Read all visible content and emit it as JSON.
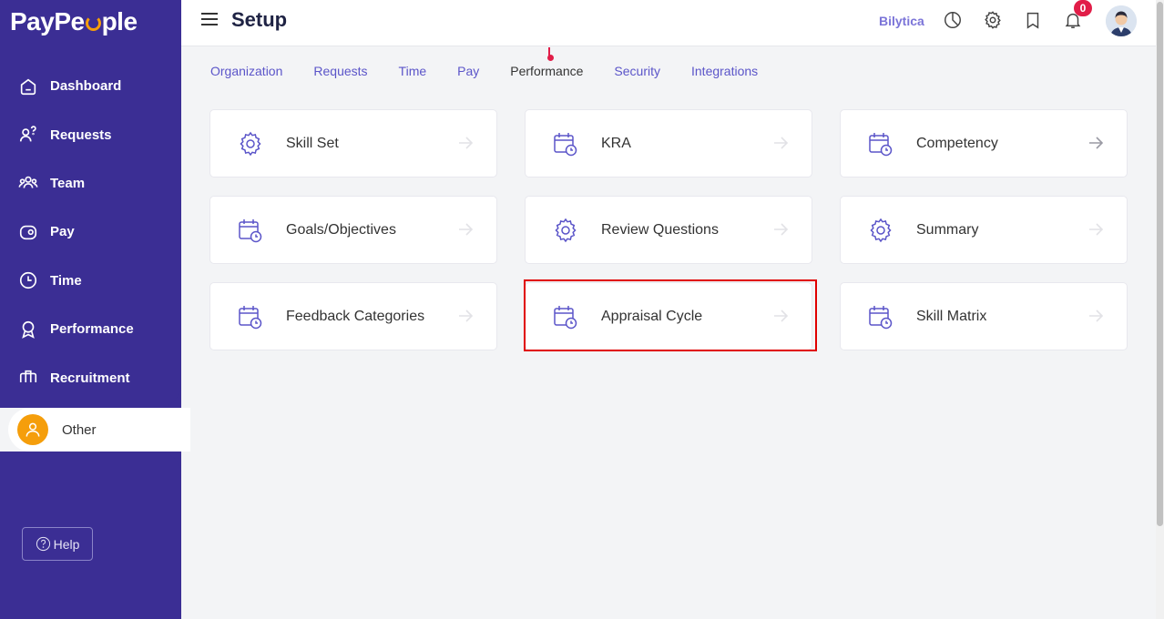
{
  "app": {
    "logo_text_a": "PayPe",
    "logo_text_b": "ple"
  },
  "sidebar": {
    "items": [
      {
        "label": "Dashboard",
        "icon": "home-icon"
      },
      {
        "label": "Requests",
        "icon": "requests-icon"
      },
      {
        "label": "Team",
        "icon": "team-icon"
      },
      {
        "label": "Pay",
        "icon": "wallet-icon"
      },
      {
        "label": "Time",
        "icon": "clock-icon"
      },
      {
        "label": "Performance",
        "icon": "award-icon"
      },
      {
        "label": "Recruitment",
        "icon": "briefcase-icon"
      }
    ],
    "active": {
      "label": "Other",
      "icon": "user-icon"
    },
    "help_label": "Help"
  },
  "header": {
    "title": "Setup",
    "company": "Bilytica",
    "notifications_count": "0"
  },
  "tabs": [
    "Organization",
    "Requests",
    "Time",
    "Pay",
    "Performance",
    "Security",
    "Integrations"
  ],
  "active_tab": "Performance",
  "cards": [
    {
      "label": "Skill Set",
      "icon": "gear-icon"
    },
    {
      "label": "KRA",
      "icon": "calendar-clock-icon"
    },
    {
      "label": "Competency",
      "icon": "calendar-clock-icon"
    },
    {
      "label": "Goals/Objectives",
      "icon": "calendar-clock-icon"
    },
    {
      "label": "Review Questions",
      "icon": "gear-icon"
    },
    {
      "label": "Summary",
      "icon": "gear-icon"
    },
    {
      "label": "Feedback Categories",
      "icon": "calendar-clock-icon"
    },
    {
      "label": "Appraisal Cycle",
      "icon": "calendar-clock-icon"
    },
    {
      "label": "Skill Matrix",
      "icon": "calendar-clock-icon"
    }
  ],
  "colors": {
    "sidebar": "#3b2e94",
    "accent": "#5b55c9",
    "highlight": "#e00000",
    "badge": "#e11d48"
  }
}
